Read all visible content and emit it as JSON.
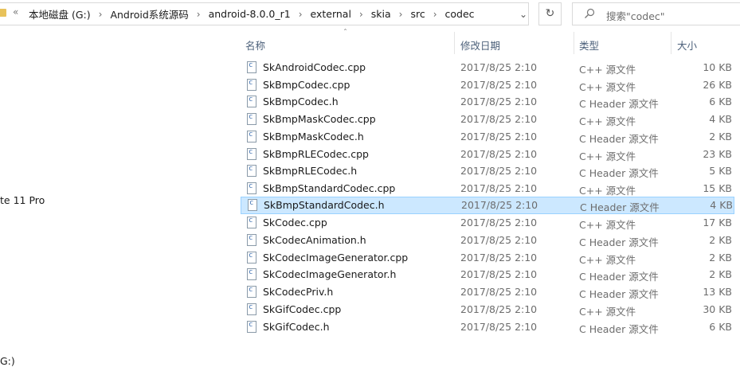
{
  "address": {
    "overflow": "«",
    "crumbs": [
      "本地磁盘 (G:)",
      "Android系统源码",
      "android-8.0.0_r1",
      "external",
      "skia",
      "src",
      "codec"
    ],
    "dropdown_icon": "chevron-down-icon",
    "refresh_icon": "refresh-icon"
  },
  "search": {
    "placeholder": "搜索\"codec\""
  },
  "nav": {
    "item1": "te 11 Pro",
    "item2": "G:)"
  },
  "columns": {
    "name": "名称",
    "modified": "修改日期",
    "type": "类型",
    "size": "大小"
  },
  "files": [
    {
      "name": "SkAndroidCodec.cpp",
      "modified": "2017/8/25 2:10",
      "type": "C++ 源文件",
      "size": "10 KB"
    },
    {
      "name": "SkBmpCodec.cpp",
      "modified": "2017/8/25 2:10",
      "type": "C++ 源文件",
      "size": "26 KB"
    },
    {
      "name": "SkBmpCodec.h",
      "modified": "2017/8/25 2:10",
      "type": "C Header 源文件",
      "size": "6 KB"
    },
    {
      "name": "SkBmpMaskCodec.cpp",
      "modified": "2017/8/25 2:10",
      "type": "C++ 源文件",
      "size": "4 KB"
    },
    {
      "name": "SkBmpMaskCodec.h",
      "modified": "2017/8/25 2:10",
      "type": "C Header 源文件",
      "size": "2 KB"
    },
    {
      "name": "SkBmpRLECodec.cpp",
      "modified": "2017/8/25 2:10",
      "type": "C++ 源文件",
      "size": "23 KB"
    },
    {
      "name": "SkBmpRLECodec.h",
      "modified": "2017/8/25 2:10",
      "type": "C Header 源文件",
      "size": "5 KB"
    },
    {
      "name": "SkBmpStandardCodec.cpp",
      "modified": "2017/8/25 2:10",
      "type": "C++ 源文件",
      "size": "15 KB"
    },
    {
      "name": "SkBmpStandardCodec.h",
      "modified": "2017/8/25 2:10",
      "type": "C Header 源文件",
      "size": "4 KB",
      "selected": true
    },
    {
      "name": "SkCodec.cpp",
      "modified": "2017/8/25 2:10",
      "type": "C++ 源文件",
      "size": "17 KB"
    },
    {
      "name": "SkCodecAnimation.h",
      "modified": "2017/8/25 2:10",
      "type": "C Header 源文件",
      "size": "2 KB"
    },
    {
      "name": "SkCodecImageGenerator.cpp",
      "modified": "2017/8/25 2:10",
      "type": "C++ 源文件",
      "size": "2 KB"
    },
    {
      "name": "SkCodecImageGenerator.h",
      "modified": "2017/8/25 2:10",
      "type": "C Header 源文件",
      "size": "2 KB"
    },
    {
      "name": "SkCodecPriv.h",
      "modified": "2017/8/25 2:10",
      "type": "C Header 源文件",
      "size": "13 KB"
    },
    {
      "name": "SkGifCodec.cpp",
      "modified": "2017/8/25 2:10",
      "type": "C++ 源文件",
      "size": "30 KB"
    },
    {
      "name": "SkGifCodec.h",
      "modified": "2017/8/25 2:10",
      "type": "C Header 源文件",
      "size": "6 KB"
    }
  ],
  "colors": {
    "selected_bg": "#cce8ff",
    "selected_border": "#99d1ff",
    "header_text": "#4c607a"
  }
}
